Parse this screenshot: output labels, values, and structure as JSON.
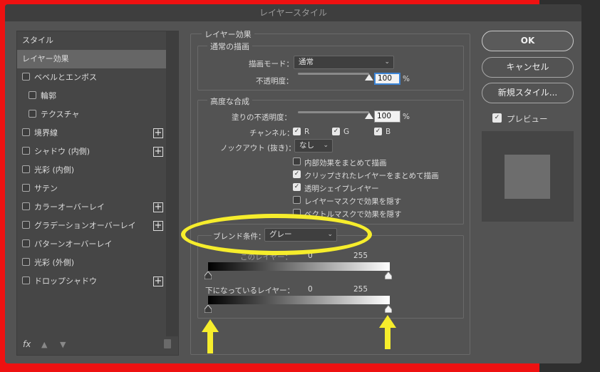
{
  "window": {
    "title": "レイヤースタイル"
  },
  "left_panel": {
    "items": [
      {
        "label": "スタイル",
        "checkbox": false,
        "plus": false,
        "active": false
      },
      {
        "label": "レイヤー効果",
        "checkbox": false,
        "plus": false,
        "active": true
      },
      {
        "label": "ベベルとエンボス",
        "checkbox": true,
        "plus": false,
        "active": false
      },
      {
        "label": "輪郭",
        "checkbox": true,
        "plus": false,
        "active": false,
        "indent": true
      },
      {
        "label": "テクスチャ",
        "checkbox": true,
        "plus": false,
        "active": false,
        "indent": true
      },
      {
        "label": "境界線",
        "checkbox": true,
        "plus": true,
        "active": false
      },
      {
        "label": "シャドウ (内側)",
        "checkbox": true,
        "plus": true,
        "active": false
      },
      {
        "label": "光彩 (内側)",
        "checkbox": true,
        "plus": false,
        "active": false
      },
      {
        "label": "サテン",
        "checkbox": true,
        "plus": false,
        "active": false
      },
      {
        "label": "カラーオーバーレイ",
        "checkbox": true,
        "plus": true,
        "active": false
      },
      {
        "label": "グラデーションオーバーレイ",
        "checkbox": true,
        "plus": true,
        "active": false
      },
      {
        "label": "パターンオーバーレイ",
        "checkbox": true,
        "plus": false,
        "active": false
      },
      {
        "label": "光彩 (外側)",
        "checkbox": true,
        "plus": false,
        "active": false
      },
      {
        "label": "ドロップシャドウ",
        "checkbox": true,
        "plus": true,
        "active": false
      }
    ],
    "fx_label": "fx"
  },
  "effects": {
    "title": "レイヤー効果",
    "normal_blend": {
      "title": "通常の描画",
      "blend_mode_label": "描画モード：",
      "blend_mode_value": "通常",
      "opacity_label": "不透明度：",
      "opacity_value": "100",
      "opacity_unit": "%",
      "opacity_fraction": 1.0
    },
    "advanced_blend": {
      "title": "高度な合成",
      "fill_opacity_label": "塗りの不透明度：",
      "fill_opacity_value": "100",
      "fill_opacity_unit": "%",
      "fill_opacity_fraction": 1.0,
      "channels_label": "チャンネル：",
      "channel_r": "R",
      "channel_g": "G",
      "channel_b": "B",
      "knockout_label": "ノックアウト (抜き)：",
      "knockout_value": "なし",
      "options": [
        {
          "label": "内部効果をまとめて描画",
          "checked": false
        },
        {
          "label": "クリップされたレイヤーをまとめて描画",
          "checked": true
        },
        {
          "label": "透明シェイプレイヤー",
          "checked": true
        },
        {
          "label": "レイヤーマスクで効果を隠す",
          "checked": false
        },
        {
          "label": "ベクトルマスクで効果を隠す",
          "checked": false
        }
      ]
    },
    "blend_if": {
      "label": "ブレンド条件：",
      "value": "グレー",
      "this_layer_label": "このレイヤー：",
      "this_layer_min": "0",
      "this_layer_max": "255",
      "underlying_label": "下になっているレイヤー：",
      "underlying_min": "0",
      "underlying_max": "255"
    }
  },
  "buttons": {
    "ok": "OK",
    "cancel": "キャンセル",
    "new_style": "新規スタイル...",
    "preview_label": "プレビュー",
    "preview_checked": true
  },
  "colors": {
    "annotation": "#f6ed2c",
    "background_red": "#ee1111",
    "dialog_bg": "#535353"
  }
}
